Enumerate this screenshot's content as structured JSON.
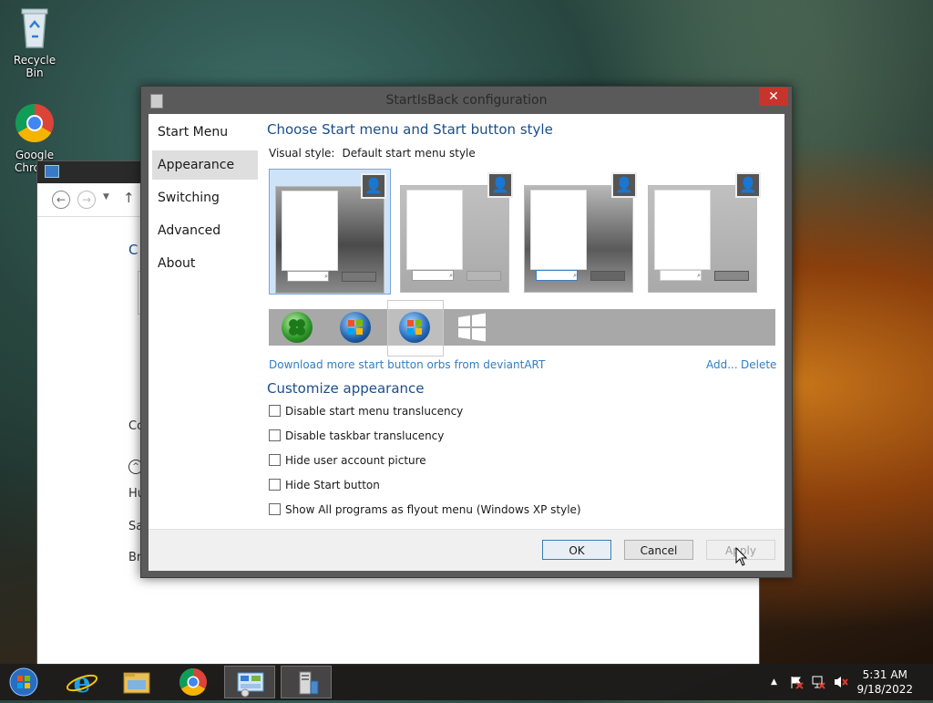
{
  "desktop": {
    "icons": [
      {
        "label": "Recycle Bin",
        "icon": "recycle-bin-icon"
      },
      {
        "label": "Google Chrome",
        "icon": "chrome-icon"
      }
    ]
  },
  "background_window": {
    "fragments": [
      "C",
      "Co",
      "Hu",
      "Sa",
      "Br"
    ]
  },
  "dialog": {
    "title": "StartIsBack configuration",
    "close_label": "✕",
    "nav": [
      "Start Menu",
      "Appearance",
      "Switching",
      "Advanced",
      "About"
    ],
    "nav_selected": "Appearance",
    "heading_style": "Choose Start menu and Start button style",
    "visual_style_label": "Visual style:",
    "visual_style_value": "Default start menu style",
    "styles_count_selected": 0,
    "orbs": [
      "clover-orb",
      "windows7-orb",
      "windows7-orb-alt",
      "windows8-logo"
    ],
    "selected_orb": "windows7-orb-alt",
    "download_link": "Download more start button orbs from deviantART",
    "add_link": "Add...",
    "delete_link": "Delete",
    "heading_customize": "Customize appearance",
    "options": [
      {
        "label": "Disable start menu translucency",
        "checked": false
      },
      {
        "label": "Disable taskbar translucency",
        "checked": false
      },
      {
        "label": "Hide user account picture",
        "checked": false
      },
      {
        "label": "Hide Start button",
        "checked": false
      },
      {
        "label": "Show All programs as flyout menu (Windows XP style)",
        "checked": false
      }
    ],
    "buttons": {
      "ok": "OK",
      "cancel": "Cancel",
      "apply": "Apply"
    }
  },
  "taskbar": {
    "pinned": [
      "start-orb-icon",
      "internet-explorer-icon",
      "file-explorer-icon",
      "chrome-icon",
      "control-panel-icon",
      "startisback-config-icon"
    ],
    "tray": {
      "show_hidden": "▲"
    },
    "time": "5:31 AM",
    "date": "9/18/2022"
  },
  "colors": {
    "heading": "#1a4e8a",
    "link": "#2f7fc4",
    "close": "#c7342b",
    "selection": "#cfe3f8"
  }
}
